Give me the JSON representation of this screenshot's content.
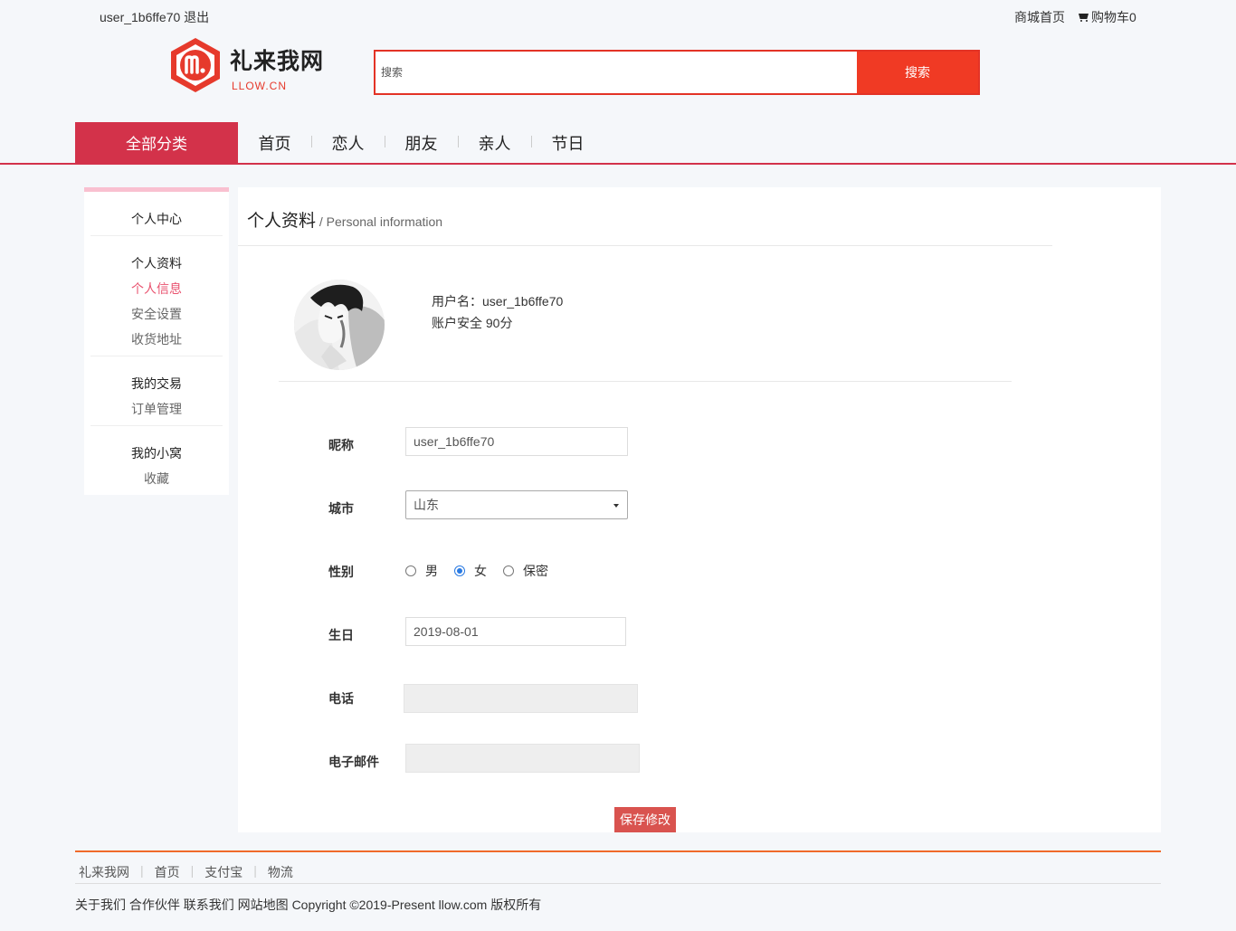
{
  "topbar": {
    "username": "user_1b6ffe70",
    "logout": "退出",
    "home_link": "商城首页",
    "cart_label": "购物车0"
  },
  "logo": {
    "name": "礼来我网",
    "sub": "LLOW.CN"
  },
  "search": {
    "placeholder": "搜索",
    "button": "搜索"
  },
  "nav": {
    "all_categories": "全部分类",
    "items": [
      "首页",
      "恋人",
      "朋友",
      "亲人",
      "节日"
    ]
  },
  "sidebar": {
    "center": "个人中心",
    "group1_title": "个人资料",
    "group1_items": [
      "个人信息",
      "安全设置",
      "收货地址"
    ],
    "group2_title": "我的交易",
    "group2_items": [
      "订单管理"
    ],
    "group3_title": "我的小窝",
    "group3_items": [
      "收藏"
    ]
  },
  "main": {
    "title": "个人资料",
    "subtitle": " / Personal information",
    "username_line": "用户名：user_1b6ffe70",
    "security_line": "账户安全 90分"
  },
  "form": {
    "nickname_label": "昵称",
    "nickname_value": "user_1b6ffe70",
    "city_label": "城市",
    "city_value": "山东",
    "gender_label": "性别",
    "gender_options": [
      "男",
      "女",
      "保密"
    ],
    "gender_selected": "女",
    "birthday_label": "生日",
    "birthday_value": "2019-08-01",
    "phone_label": "电话",
    "phone_value": "",
    "email_label": "电子邮件",
    "email_value": "",
    "save_button": "保存修改"
  },
  "footer": {
    "links": [
      "礼来我网",
      "首页",
      "支付宝",
      "物流"
    ],
    "bottom_links": [
      "关于我们",
      "合作伙伴",
      "联系我们",
      "网站地图"
    ],
    "copyright": "Copyright ©2019-Present llow.com 版权所有"
  },
  "colors": {
    "accent_red": "#d3324a",
    "search_red": "#f03a24",
    "footer_orange": "#f06a2a",
    "active_pink": "#e9536f"
  }
}
